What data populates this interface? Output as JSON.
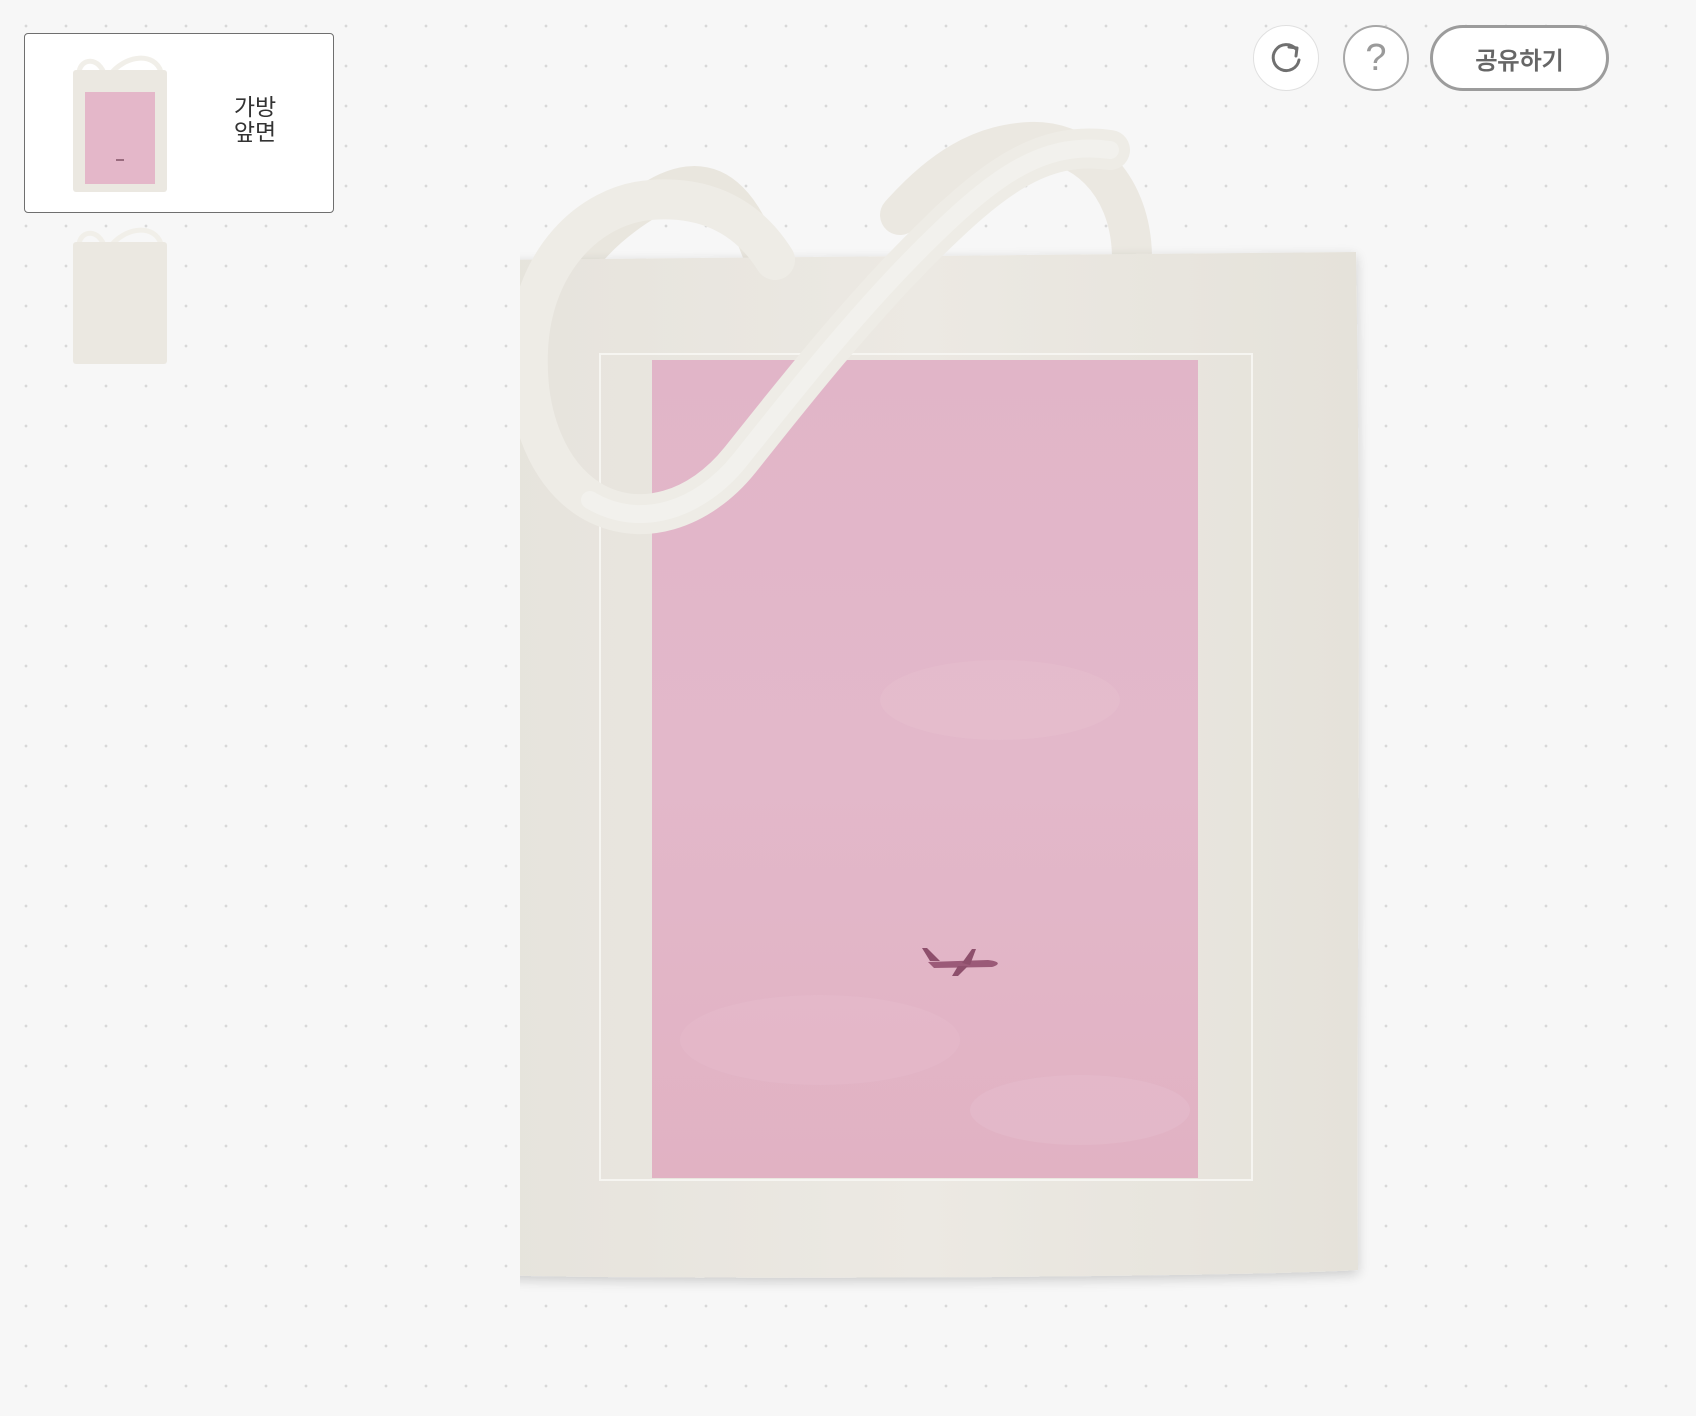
{
  "thumbnails": [
    {
      "label": "가방\n앞면",
      "selected": true,
      "has_print": true
    },
    {
      "label": "",
      "selected": false,
      "has_print": false
    }
  ],
  "toolbar": {
    "refresh_icon": "refresh-icon",
    "help_icon": "help-icon",
    "help_glyph": "?",
    "share_label": "공유하기"
  },
  "product": {
    "type": "tote-bag",
    "bag_color": "#ebe8e1",
    "print_color": "#e2b4c7"
  }
}
